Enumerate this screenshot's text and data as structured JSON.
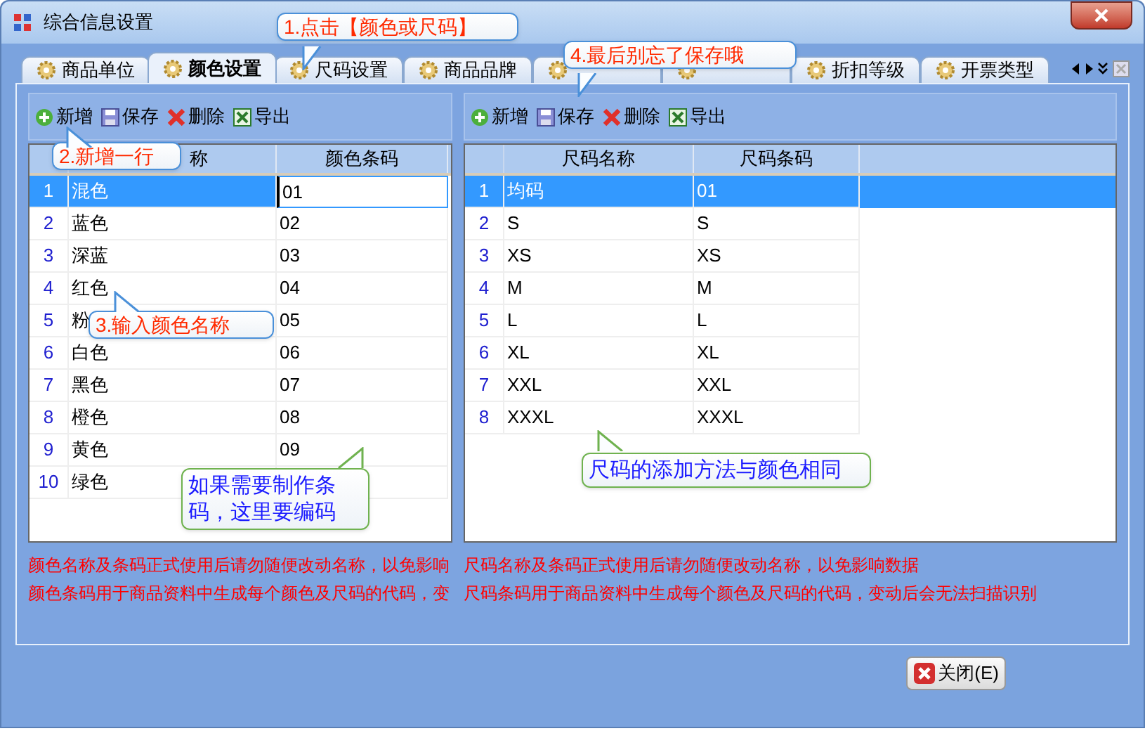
{
  "window": {
    "title": "综合信息设置"
  },
  "tabs": [
    {
      "label": "商品单位",
      "selected": false
    },
    {
      "label": "颜色设置",
      "selected": true
    },
    {
      "label": "尺码设置",
      "selected": false
    },
    {
      "label": "商品品牌",
      "selected": false
    },
    {
      "selected": false
    },
    {
      "selected": false
    },
    {
      "label": "折扣等级",
      "selected": false
    },
    {
      "label": "开票类型",
      "selected": false
    }
  ],
  "panels": [
    {
      "toolbar": [
        {
          "kind": "add",
          "label": "新增"
        },
        {
          "kind": "save",
          "label": "保存"
        },
        {
          "kind": "delete",
          "label": "删除"
        },
        {
          "kind": "export",
          "label": "导出"
        }
      ],
      "columns": [
        "称",
        "颜色条码"
      ],
      "rows": [
        {
          "num": "1",
          "name": "混色",
          "code": "01",
          "selected": true
        },
        {
          "num": "2",
          "name": "蓝色",
          "code": "02",
          "selected": false
        },
        {
          "num": "3",
          "name": "深蓝",
          "code": "03",
          "selected": false
        },
        {
          "num": "4",
          "name": "红色",
          "code": "04",
          "selected": false
        },
        {
          "num": "5",
          "name": "粉",
          "code": "05",
          "selected": false
        },
        {
          "num": "6",
          "name": "白色",
          "code": "06",
          "selected": false
        },
        {
          "num": "7",
          "name": "黑色",
          "code": "07",
          "selected": false
        },
        {
          "num": "8",
          "name": "橙色",
          "code": "08",
          "selected": false
        },
        {
          "num": "9",
          "name": "黄色",
          "code": "09",
          "selected": false
        },
        {
          "num": "10",
          "name": "绿色",
          "selected": false
        }
      ],
      "notes": [
        "颜色名称及条码正式使用后请勿随便改动名称，以免影响",
        "颜色条码用于商品资料中生成每个颜色及尺码的代码，变"
      ]
    },
    {
      "toolbar": [
        {
          "kind": "add",
          "label": "新增"
        },
        {
          "kind": "save",
          "label": "保存"
        },
        {
          "kind": "delete",
          "label": "删除"
        },
        {
          "kind": "export",
          "label": "导出"
        }
      ],
      "columns": [
        "尺码名称",
        "尺码条码"
      ],
      "rows": [
        {
          "num": "1",
          "name": "均码",
          "code": "01",
          "selected": true
        },
        {
          "num": "2",
          "name": "S",
          "code": "S",
          "selected": false
        },
        {
          "num": "3",
          "name": "XS",
          "code": "XS",
          "selected": false
        },
        {
          "num": "4",
          "name": "M",
          "code": "M",
          "selected": false
        },
        {
          "num": "5",
          "name": "L",
          "code": "L",
          "selected": false
        },
        {
          "num": "6",
          "name": "XL",
          "code": "XL",
          "selected": false
        },
        {
          "num": "7",
          "name": "XXL",
          "code": "XXL",
          "selected": false
        },
        {
          "num": "8",
          "name": "XXXL",
          "code": "XXXL",
          "selected": false
        }
      ],
      "notes": [
        "尺码名称及条码正式使用后请勿随便改动名称，以免影响数据",
        "尺码条码用于商品资料中生成每个颜色及尺码的代码，变动后会无法扫描识别"
      ]
    }
  ],
  "close_button": {
    "label": "关闭(E)"
  },
  "callouts": [
    {
      "kind": "step",
      "text": "1.点击【颜色或尺码】"
    },
    {
      "kind": "step",
      "text": "4.最后别忘了保存哦"
    },
    {
      "kind": "step",
      "text": "2.新增一行"
    },
    {
      "kind": "step",
      "text": "3.输入颜色名称"
    },
    {
      "kind": "note",
      "text": "如果需要制作条码，这里要编码"
    },
    {
      "kind": "note",
      "text": "尺码的添加方法与颜色相同"
    }
  ]
}
